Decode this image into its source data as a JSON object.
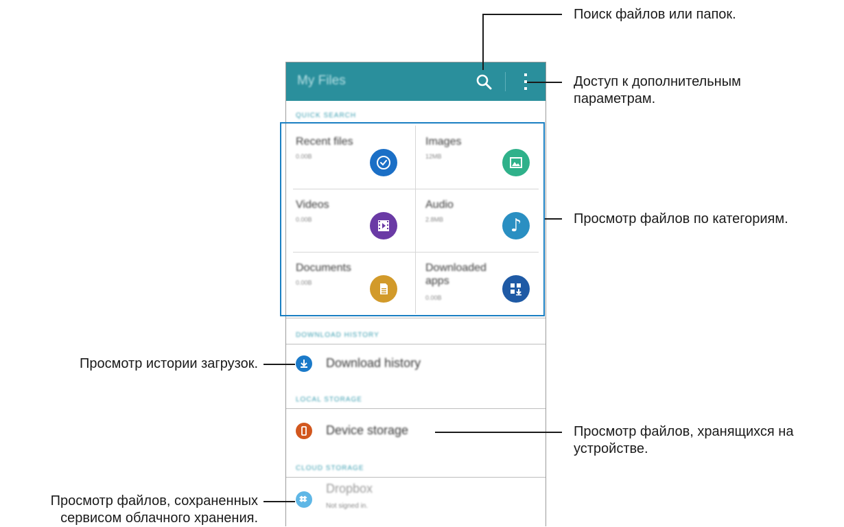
{
  "app": {
    "title": "My Files",
    "search_icon": "search-icon",
    "more_icon": "more-vertical-icon"
  },
  "sections": {
    "quick_search": "QUICK SEARCH",
    "download_history": "DOWNLOAD HISTORY",
    "local_storage": "LOCAL STORAGE",
    "cloud_storage": "CLOUD STORAGE"
  },
  "categories": [
    {
      "name": "Recent files",
      "size": "0.00B",
      "icon": "clock-icon",
      "color": "#1b6fc6"
    },
    {
      "name": "Images",
      "size": "12MB",
      "icon": "image-icon",
      "color": "#2fb18a"
    },
    {
      "name": "Videos",
      "size": "0.00B",
      "icon": "film-icon",
      "color": "#6a3aa5"
    },
    {
      "name": "Audio",
      "size": "2.8MB",
      "icon": "music-note-icon",
      "color": "#2a8fc2"
    },
    {
      "name": "Documents",
      "size": "0.00B",
      "icon": "document-icon",
      "color": "#d29a2a"
    },
    {
      "name": "Downloaded apps",
      "size": "0.00B",
      "icon": "download-apps-icon",
      "color": "#1f5aa5"
    }
  ],
  "lists": {
    "download_history": {
      "label": "Download history",
      "icon": "download-icon",
      "color": "#1b7ac9"
    },
    "device_storage": {
      "label": "Device storage",
      "icon": "phone-icon",
      "color": "#d2571e"
    },
    "dropbox": {
      "label": "Dropbox",
      "sub": "Not signed in.",
      "icon": "dropbox-icon",
      "color": "#5fb7e6"
    }
  },
  "callouts": {
    "search": "Поиск файлов или папок.",
    "more_line1": "Доступ к дополнительным",
    "more_line2": "параметрам.",
    "categories": "Просмотр файлов по категориям.",
    "download_history": "Просмотр истории загрузок.",
    "device_line1": "Просмотр файлов, хранящихся на",
    "device_line2": "устройстве.",
    "cloud_line1": "Просмотр файлов, сохраненных",
    "cloud_line2": "сервисом облачного хранения."
  }
}
